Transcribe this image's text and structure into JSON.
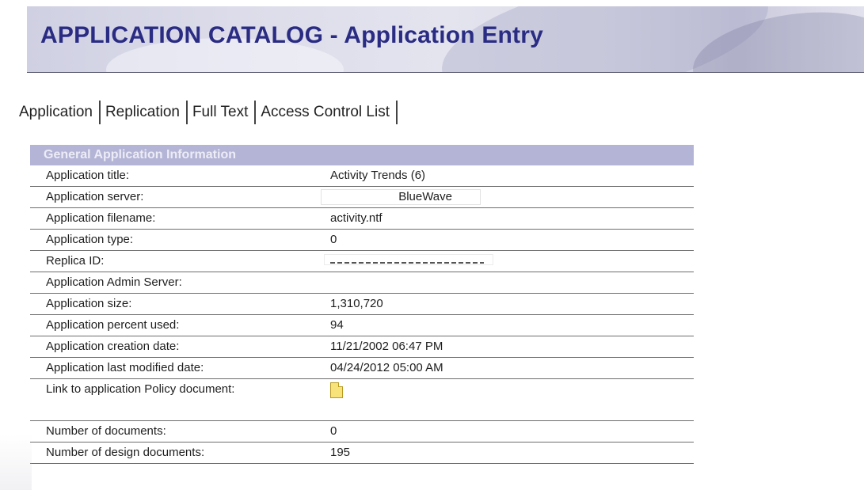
{
  "header": {
    "title": "APPLICATION CATALOG  -  Application Entry"
  },
  "tabs": [
    {
      "label": "Application"
    },
    {
      "label": "Replication"
    },
    {
      "label": "Full Text"
    },
    {
      "label": "Access Control List"
    }
  ],
  "section": {
    "title": "General Application Information"
  },
  "fields": {
    "title": {
      "label": "Application title:",
      "value": "Activity Trends (6)"
    },
    "server": {
      "label": "Application server:",
      "value": "BlueWave"
    },
    "filename": {
      "label": "Application filename:",
      "value": "activity.ntf"
    },
    "type": {
      "label": "Application type:",
      "value": "0"
    },
    "replica_id": {
      "label": "Replica ID:",
      "value": ""
    },
    "admin_server": {
      "label": "Application Admin Server:",
      "value": ""
    },
    "size": {
      "label": "Application size:",
      "value": "1,310,720"
    },
    "percent_used": {
      "label": "Application percent used:",
      "value": "94"
    },
    "creation_date": {
      "label": "Application creation date:",
      "value": "11/21/2002 06:47 PM"
    },
    "modified_date": {
      "label": "Application last modified date:",
      "value": "04/24/2012 05:00 AM"
    },
    "policy_link": {
      "label": "Link to application Policy document:",
      "icon": "document-icon"
    },
    "num_documents": {
      "label": "Number of documents:",
      "value": "0"
    },
    "num_design_documents": {
      "label": "Number of design documents:",
      "value": "195"
    }
  },
  "colors": {
    "title": "#2a2c83",
    "section_header_bg": "#b4b4d6",
    "section_header_text": "#ececf7",
    "row_border": "#6e6e6e"
  }
}
